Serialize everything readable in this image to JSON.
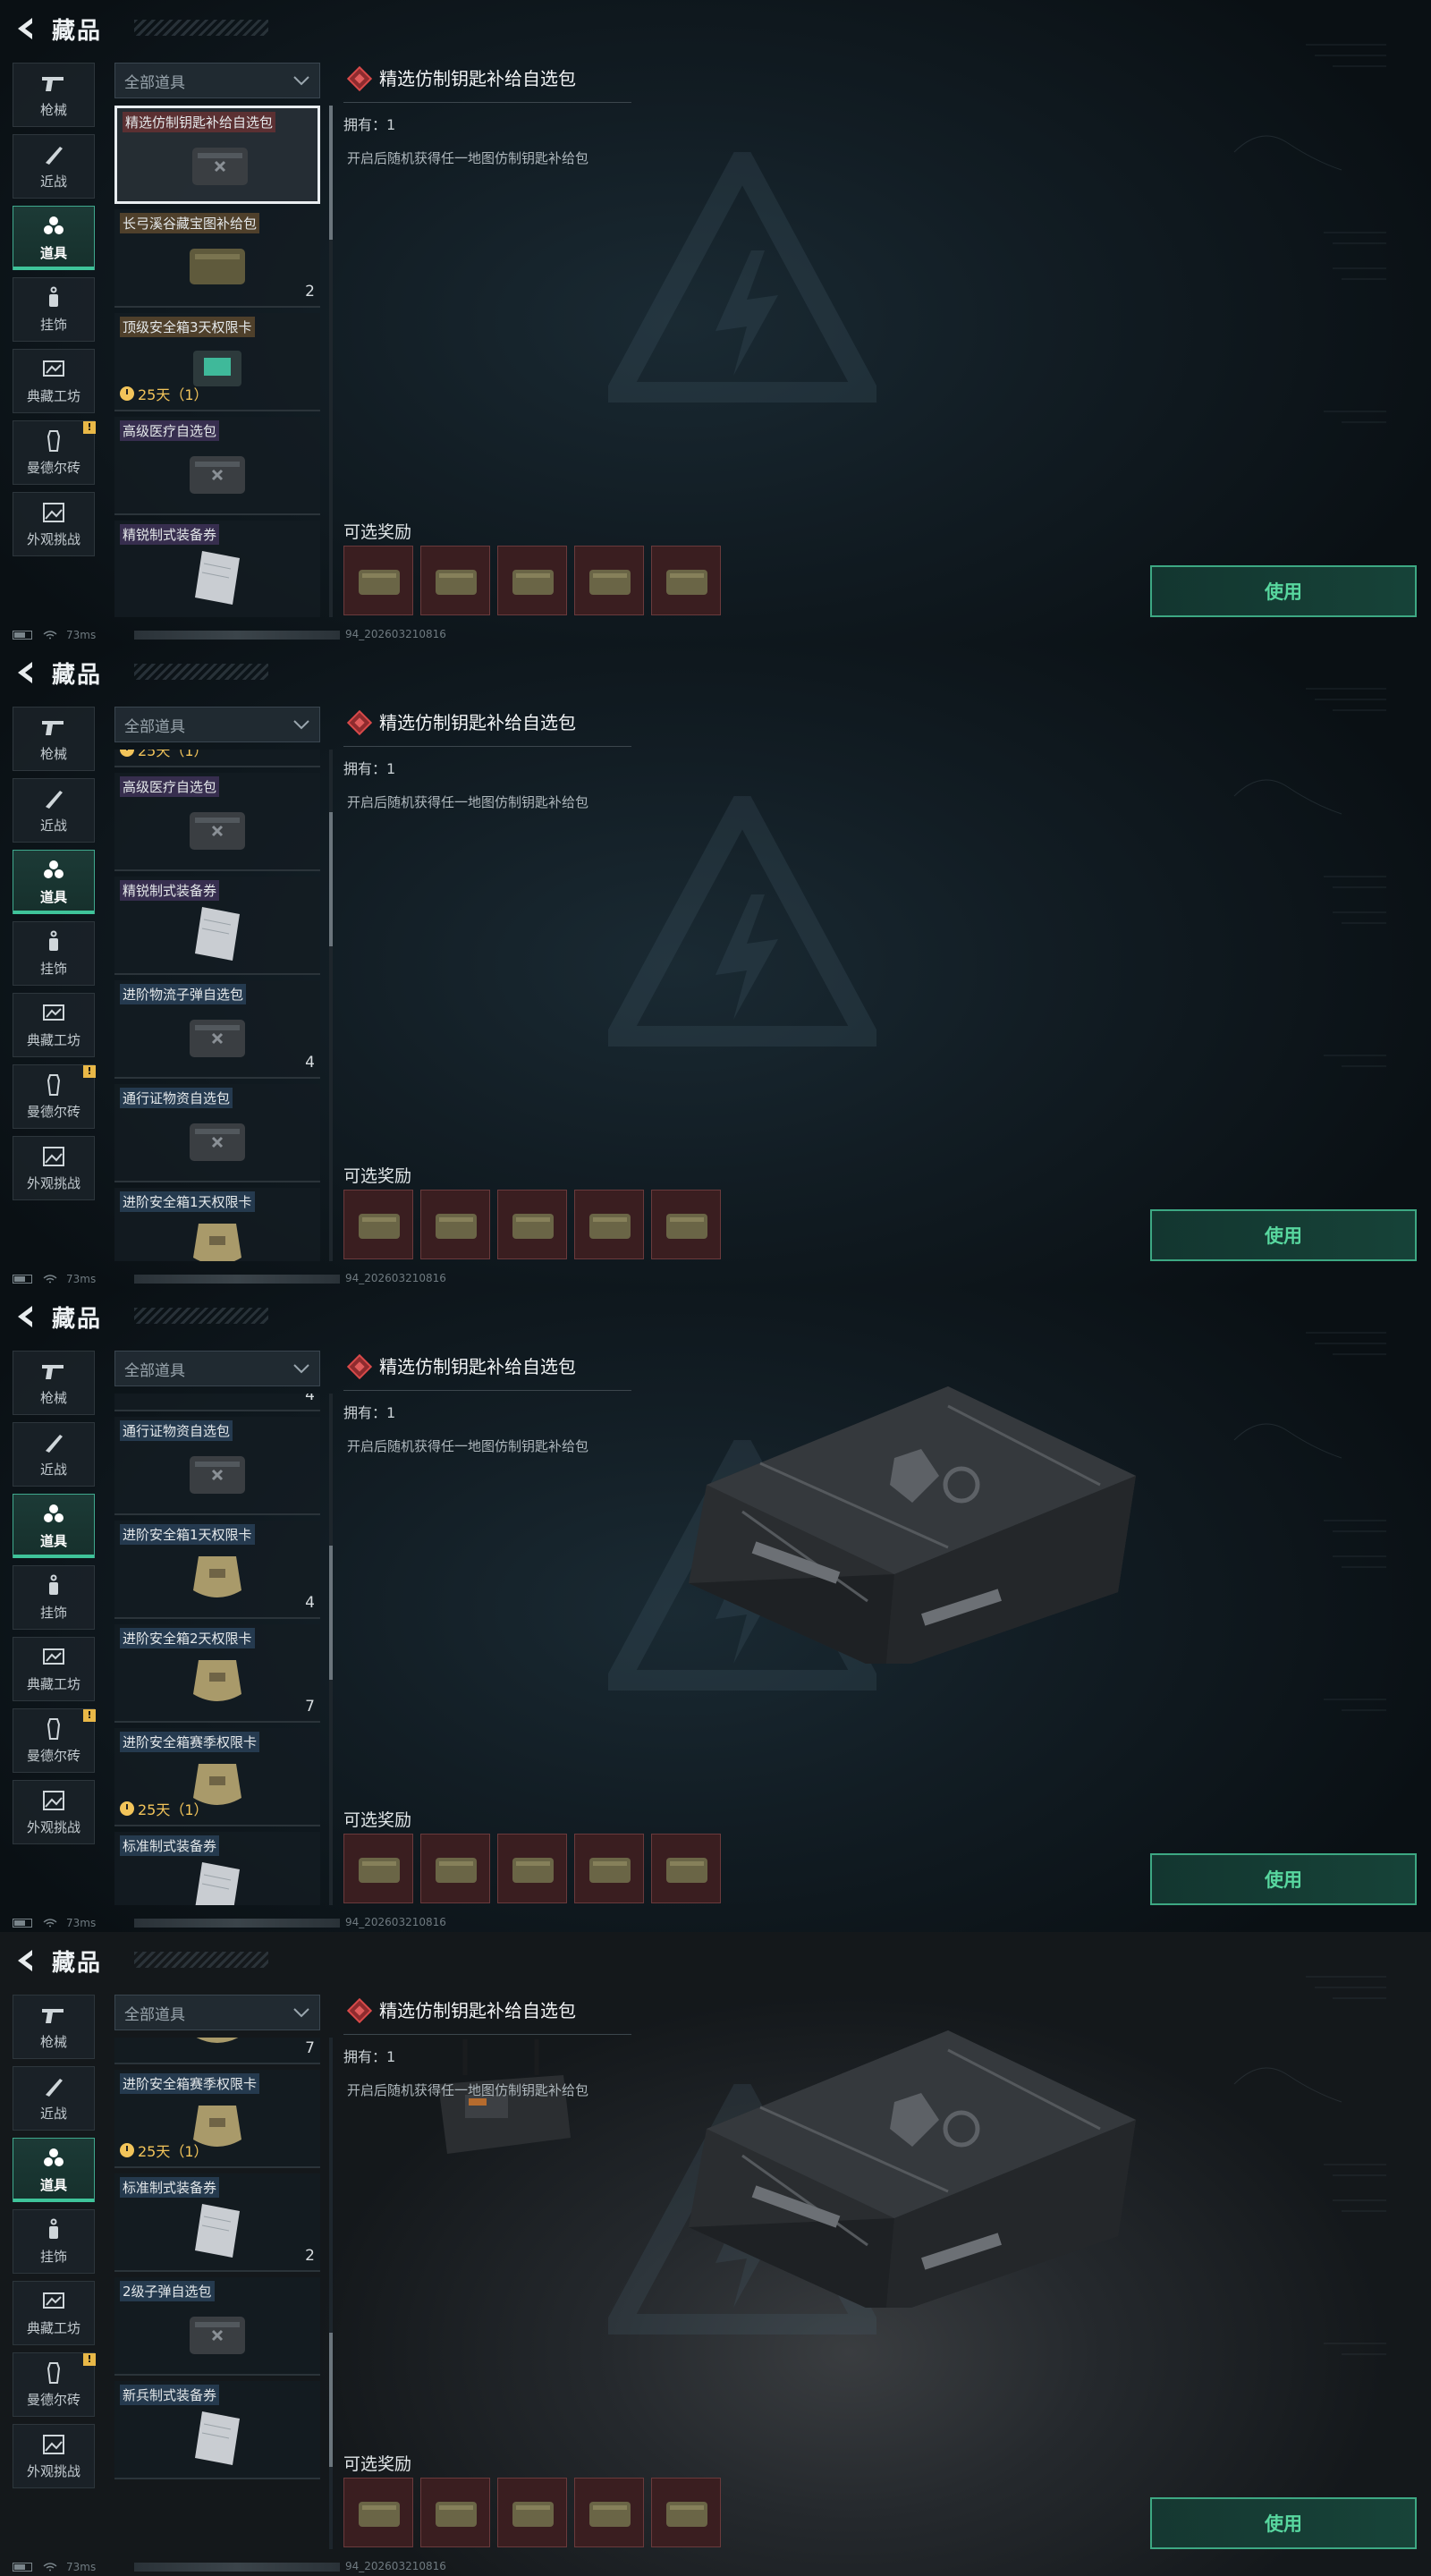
{
  "header": {
    "title": "藏品"
  },
  "categories": [
    {
      "label": "枪械",
      "icon": "gun-icon"
    },
    {
      "label": "近战",
      "icon": "knife-icon"
    },
    {
      "label": "道具",
      "icon": "items-icon",
      "active": true
    },
    {
      "label": "挂饰",
      "icon": "charm-icon"
    },
    {
      "label": "典藏工坊",
      "icon": "workshop-icon"
    },
    {
      "label": "曼德尔砖",
      "icon": "mandel-brick-icon",
      "badge": "!"
    },
    {
      "label": "外观挑战",
      "icon": "appearance-challenge-icon"
    }
  ],
  "filter": {
    "label": "全部道具"
  },
  "items": [
    {
      "name": "精选仿制钥匙补给自选包",
      "count": "",
      "timer": ""
    },
    {
      "name": "长弓溪谷藏宝图补给包",
      "count": "2",
      "timer": ""
    },
    {
      "name": "顶级安全箱3天权限卡",
      "count": "",
      "timer": "25天（1）"
    },
    {
      "name": "高级医疗自选包",
      "count": "",
      "timer": ""
    },
    {
      "name": "精锐制式装备券",
      "count": "",
      "timer": ""
    },
    {
      "name": "进阶物流子弹自选包",
      "count": "4",
      "timer": ""
    },
    {
      "name": "通行证物资自选包",
      "count": "",
      "timer": ""
    },
    {
      "name": "进阶安全箱1天权限卡",
      "count": "4",
      "timer": ""
    },
    {
      "name": "进阶安全箱2天权限卡",
      "count": "7",
      "timer": ""
    },
    {
      "name": "进阶安全箱赛季权限卡",
      "count": "",
      "timer": "25天（1）"
    },
    {
      "name": "标准制式装备券",
      "count": "2",
      "timer": ""
    },
    {
      "name": "2级子弹自选包",
      "count": "",
      "timer": ""
    },
    {
      "name": "新兵制式装备券",
      "count": "",
      "timer": ""
    }
  ],
  "detail": {
    "title": "精选仿制钥匙补给自选包",
    "owned": "拥有：1",
    "description": "开启后随机获得任一地图仿制钥匙补给包",
    "rewards_title": "可选奖励",
    "use_label": "使用"
  },
  "status": {
    "ping": "73ms",
    "build": "94_202603210816"
  },
  "colors": {
    "accent": "#3fc49a",
    "use_text": "#58d79f",
    "timer": "#f2c45a",
    "reward_bg": "#3a1e20"
  }
}
